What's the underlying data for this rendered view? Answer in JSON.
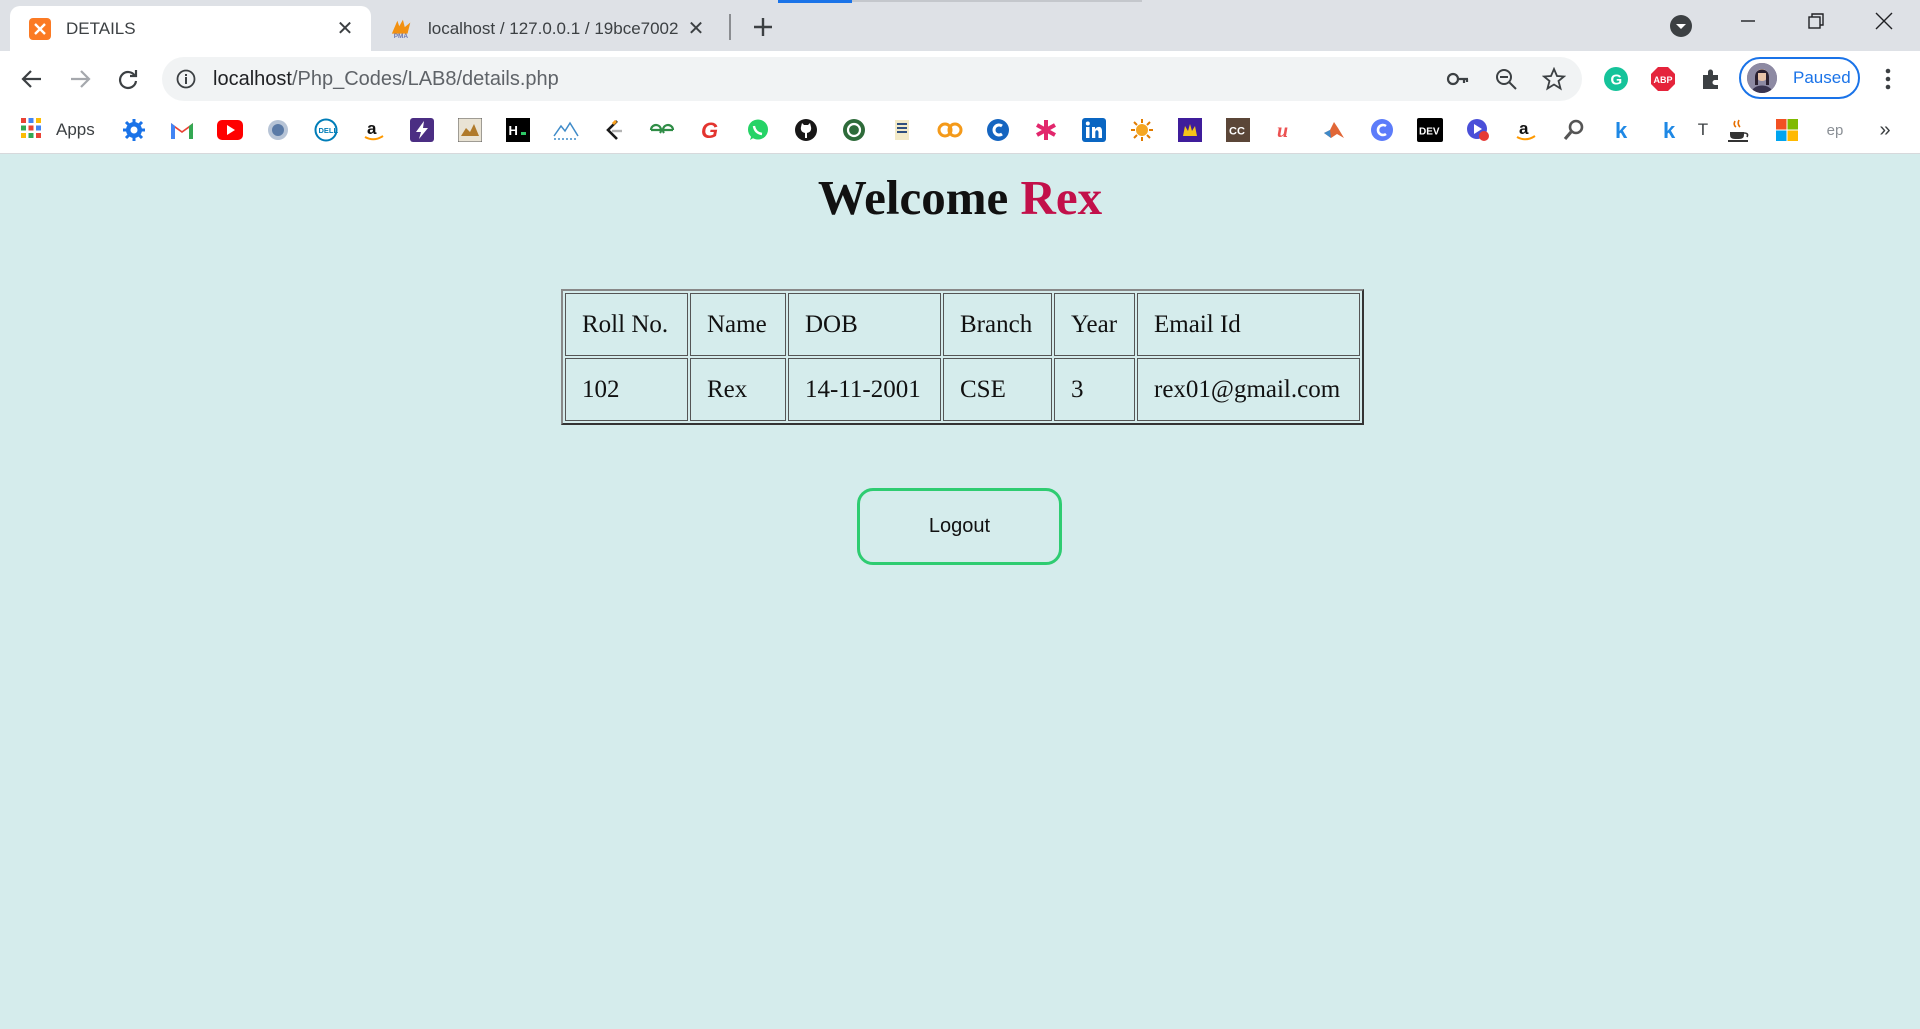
{
  "tabs": [
    {
      "title": "DETAILS",
      "active": true,
      "favicon": "xampp-icon"
    },
    {
      "title": "localhost / 127.0.0.1 / 19bce7002",
      "active": false,
      "favicon": "phpmyadmin-icon"
    }
  ],
  "toolbar": {
    "url_host": "localhost",
    "url_path": "/Php_Codes/LAB8/details.php",
    "profile_label": "Paused"
  },
  "bookmarks": {
    "apps_label": "Apps",
    "items": [
      "gear-icon",
      "gmail-icon",
      "youtube-icon",
      "emblem-icon",
      "dell-icon",
      "amazon-icon",
      "bolt-icon",
      "tiger-icon",
      "hackerrank-icon",
      "mountains-icon",
      "leetcode-icon",
      "geeksforgeeks-icon",
      "grammarly-g-icon",
      "whatsapp-icon",
      "github-icon",
      "circle-green-icon",
      "book-icon",
      "coursera-icon",
      "c-blue-icon",
      "asterisk-icon",
      "linkedin-icon",
      "sun-icon",
      "crown-icon",
      "cc-icon",
      "udemy-icon",
      "matlab-icon",
      "c-circle-icon",
      "dev-icon",
      "play-icon",
      "amazon2-icon",
      "search-icon",
      "k-icon",
      "k2-icon",
      "t-icon",
      "java-icon",
      "microsoft-icon",
      "ep-icon"
    ],
    "t_label": "T",
    "ep_label": "ep"
  },
  "page": {
    "welcome_text": "Welcome",
    "user_name": "Rex",
    "table": {
      "headers": [
        "Roll No.",
        "Name",
        "DOB",
        "Branch",
        "Year",
        "Email Id"
      ],
      "rows": [
        [
          "102",
          "Rex",
          "14-11-2001",
          "CSE",
          "3",
          "rex01@gmail.com"
        ]
      ]
    },
    "logout_label": "Logout"
  },
  "colors": {
    "page_background": "#d5ecec",
    "name_accent": "#c2104a",
    "logout_border": "#2ecc71",
    "profile_accent": "#1a73e8"
  }
}
